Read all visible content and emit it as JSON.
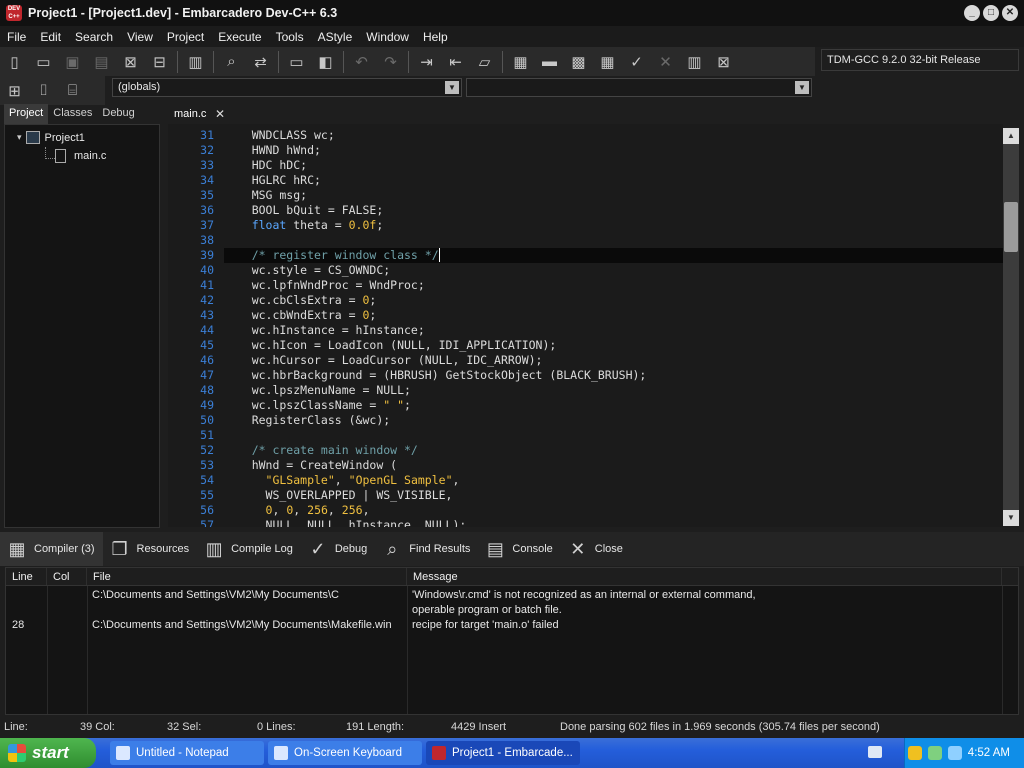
{
  "window": {
    "title": "Project1 - [Project1.dev] - Embarcadero Dev-C++ 6.3",
    "app_icon_text": "DEV C++",
    "controls": {
      "minimize": "_",
      "maximize": "□",
      "close": "✕"
    }
  },
  "menu": [
    "File",
    "Edit",
    "Search",
    "View",
    "Project",
    "Execute",
    "Tools",
    "AStyle",
    "Window",
    "Help"
  ],
  "toolbar": {
    "compiler": "TDM-GCC 9.2.0 32-bit Release",
    "globals_combo": "(globals)",
    "function_combo": ""
  },
  "left_panel": {
    "tabs": [
      "Project",
      "Classes",
      "Debug"
    ],
    "active_tab": "Project",
    "tree": {
      "project": "Project1",
      "file": "main.c",
      "expander": "▾"
    }
  },
  "editor": {
    "tab": "main.c",
    "tab_close": "✕",
    "lines": [
      {
        "n": "31",
        "t": [
          [
            "plain",
            "    WNDCLASS wc;"
          ]
        ]
      },
      {
        "n": "32",
        "t": [
          [
            "plain",
            "    HWND hWnd;"
          ]
        ]
      },
      {
        "n": "33",
        "t": [
          [
            "plain",
            "    HDC hDC;"
          ]
        ]
      },
      {
        "n": "34",
        "t": [
          [
            "plain",
            "    HGLRC hRC;"
          ]
        ]
      },
      {
        "n": "35",
        "t": [
          [
            "plain",
            "    MSG msg;"
          ]
        ]
      },
      {
        "n": "36",
        "t": [
          [
            "plain",
            "    BOOL bQuit = FALSE;"
          ]
        ]
      },
      {
        "n": "37",
        "t": [
          [
            "kw",
            "    float"
          ],
          [
            "plain",
            " theta = "
          ],
          [
            "num",
            "0.0f"
          ],
          [
            "plain",
            ";"
          ]
        ]
      },
      {
        "n": "38",
        "t": [
          [
            "plain",
            ""
          ]
        ]
      },
      {
        "n": "39",
        "t": [
          [
            "cm",
            "    /* register window class */"
          ]
        ],
        "hl": true
      },
      {
        "n": "40",
        "t": [
          [
            "plain",
            "    wc.style = CS_OWNDC;"
          ]
        ]
      },
      {
        "n": "41",
        "t": [
          [
            "plain",
            "    wc.lpfnWndProc = WndProc;"
          ]
        ]
      },
      {
        "n": "42",
        "t": [
          [
            "plain",
            "    wc.cbClsExtra = "
          ],
          [
            "num",
            "0"
          ],
          [
            "plain",
            ";"
          ]
        ]
      },
      {
        "n": "43",
        "t": [
          [
            "plain",
            "    wc.cbWndExtra = "
          ],
          [
            "num",
            "0"
          ],
          [
            "plain",
            ";"
          ]
        ]
      },
      {
        "n": "44",
        "t": [
          [
            "plain",
            "    wc.hInstance = hInstance;"
          ]
        ]
      },
      {
        "n": "45",
        "t": [
          [
            "plain",
            "    wc.hIcon = LoadIcon (NULL, IDI_APPLICATION);"
          ]
        ]
      },
      {
        "n": "46",
        "t": [
          [
            "plain",
            "    wc.hCursor = LoadCursor (NULL, IDC_ARROW);"
          ]
        ]
      },
      {
        "n": "47",
        "t": [
          [
            "plain",
            "    wc.hbrBackground = (HBRUSH) GetStockObject (BLACK_BRUSH);"
          ]
        ]
      },
      {
        "n": "48",
        "t": [
          [
            "plain",
            "    wc.lpszMenuName = NULL;"
          ]
        ]
      },
      {
        "n": "49",
        "t": [
          [
            "plain",
            "    wc.lpszClassName = "
          ],
          [
            "str",
            "\" \""
          ],
          [
            "plain",
            ";"
          ]
        ]
      },
      {
        "n": "50",
        "t": [
          [
            "plain",
            "    RegisterClass (&wc);"
          ]
        ]
      },
      {
        "n": "51",
        "t": [
          [
            "plain",
            ""
          ]
        ]
      },
      {
        "n": "52",
        "t": [
          [
            "cm",
            "    /* create main window */"
          ]
        ]
      },
      {
        "n": "53",
        "t": [
          [
            "plain",
            "    hWnd = CreateWindow ("
          ]
        ]
      },
      {
        "n": "54",
        "t": [
          [
            "str",
            "      \"GLSample\""
          ],
          [
            "plain",
            ", "
          ],
          [
            "str",
            "\"OpenGL Sample\""
          ],
          [
            "plain",
            ","
          ]
        ]
      },
      {
        "n": "55",
        "t": [
          [
            "plain",
            "      WS_OVERLAPPED | WS_VISIBLE,"
          ]
        ]
      },
      {
        "n": "56",
        "t": [
          [
            "plain",
            "      "
          ],
          [
            "num",
            "0"
          ],
          [
            "plain",
            ", "
          ],
          [
            "num",
            "0"
          ],
          [
            "plain",
            ", "
          ],
          [
            "num",
            "256"
          ],
          [
            "plain",
            ", "
          ],
          [
            "num",
            "256"
          ],
          [
            "plain",
            ","
          ]
        ]
      },
      {
        "n": "57",
        "t": [
          [
            "plain",
            "      NULL, NULL, hInstance, NULL);"
          ]
        ]
      }
    ]
  },
  "bottom_tabs": [
    {
      "label": "Compiler (3)",
      "icon": "compiler-icon",
      "glyph": "▦"
    },
    {
      "label": "Resources",
      "icon": "resources-icon",
      "glyph": "❐"
    },
    {
      "label": "Compile Log",
      "icon": "compile-log-icon",
      "glyph": "▥"
    },
    {
      "label": "Debug",
      "icon": "debug-check-icon",
      "glyph": "✓"
    },
    {
      "label": "Find Results",
      "icon": "find-results-icon",
      "glyph": "⌕"
    },
    {
      "label": "Console",
      "icon": "console-icon",
      "glyph": "▤"
    },
    {
      "label": "Close",
      "icon": "close-x-icon",
      "glyph": "✕"
    }
  ],
  "messages": {
    "headers": [
      "Line",
      "Col",
      "File",
      "Message"
    ],
    "rows": [
      {
        "line": "",
        "col": "",
        "file": "C:\\Documents and Settings\\VM2\\My Documents\\C",
        "message": "'Windows\\r.cmd' is not recognized as an internal or external command,",
        "message2": "operable program or batch file."
      },
      {
        "line": "28",
        "col": "",
        "file": "C:\\Documents and Settings\\VM2\\My Documents\\Makefile.win",
        "message": "recipe for target 'main.o' failed",
        "message2": ""
      }
    ]
  },
  "status": {
    "line_label": "Line:",
    "line_val": "39 Col:",
    "col_val": "32 Sel:",
    "sel_val": "0 Lines:",
    "lines_val": "191 Length:",
    "length_val": "4429 Insert",
    "parse_msg": "Done parsing 602 files in 1.969 seconds (305.74 files per second)"
  },
  "taskbar": {
    "start": "start",
    "tasks": [
      "Untitled - Notepad",
      "On-Screen Keyboard",
      "Project1 - Embarcade..."
    ],
    "clock": "4:52 AM"
  },
  "colors": {
    "keyword": "#5aa7ff",
    "number": "#f0c040",
    "comment": "#6fa0a8",
    "line_number": "#3b7fd6"
  }
}
